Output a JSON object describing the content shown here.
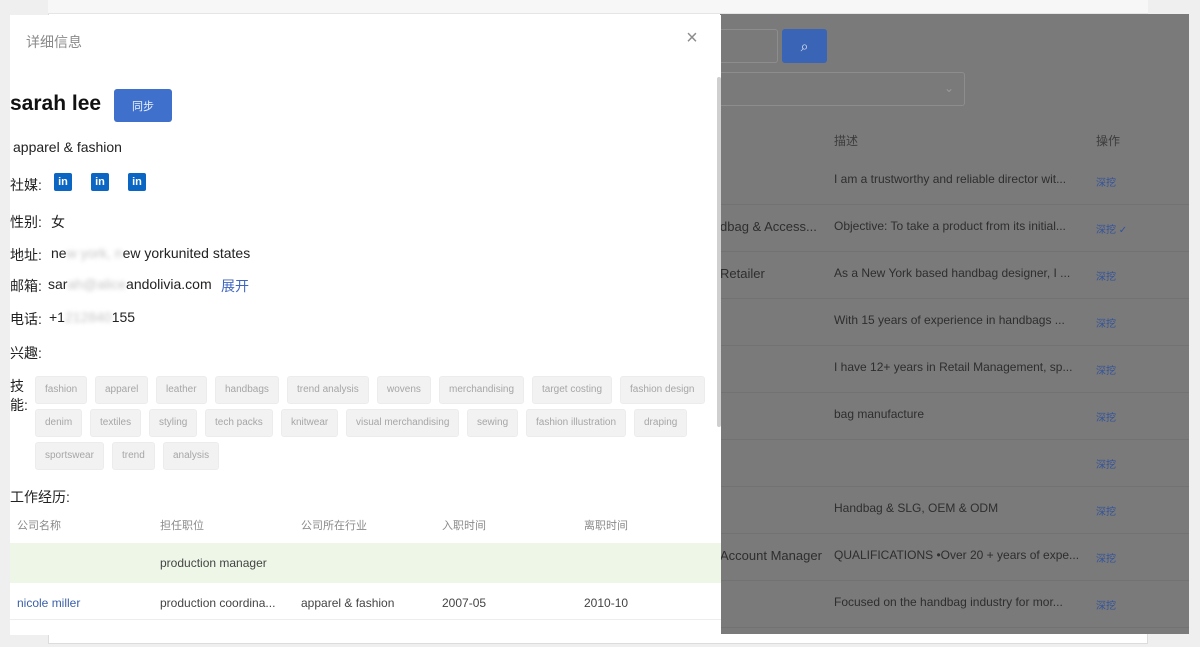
{
  "modal": {
    "title": "详细信息",
    "close": "×",
    "name": "sarah lee",
    "sync_label": "同步",
    "industry": "apparel & fashion",
    "social_label": "社媒:",
    "gender_label": "性别:",
    "gender_value": "女",
    "address_label": "地址:",
    "address_value": {
      "start": "ne",
      "hidden": "w york, n",
      "end": "ew yorkunited states"
    },
    "email_label": "邮箱:",
    "email_value": {
      "start": "sar",
      "hidden": "ah@alice",
      "end": "andolivia.com"
    },
    "expand_label": "展开",
    "phone_label": "电话:",
    "phone_value": {
      "start": "+1",
      "hidden": "212840",
      "end": "155"
    },
    "interests_label": "兴趣:",
    "skills_label_1": "技",
    "skills_label_2": "能:",
    "work_label": "工作经历:",
    "social_icons": [
      "linkedin-icon",
      "linkedin-icon",
      "linkedin-icon"
    ],
    "skill_rows": [
      [
        "fashion",
        "apparel",
        "leather",
        "handbags",
        "trend analysis",
        "wovens",
        "merchandising",
        "target costing",
        "fashion design"
      ],
      [
        "denim",
        "textiles",
        "styling",
        "tech packs",
        "knitwear",
        "visual merchandising",
        "sewing",
        "fashion illustration",
        "draping"
      ],
      [
        "sportswear",
        "trend",
        "analysis"
      ]
    ],
    "work_columns": [
      "公司名称",
      "担任职位",
      "公司所在行业",
      "入职时间",
      "离职时间"
    ],
    "work_rows": [
      [
        "",
        "production manager",
        "",
        "",
        ""
      ],
      [
        "nicole miller",
        "production coordina...",
        "apparel & fashion",
        "2007-05",
        "2010-10"
      ]
    ]
  },
  "background": {
    "search_icon": "search-icon",
    "columns": {
      "desc": "描述",
      "op": "操作"
    },
    "rows": [
      {
        "left": "",
        "desc": "I am a trustworthy and reliable director wit...",
        "op": "深挖"
      },
      {
        "left": "dbag & Access...",
        "desc": "Objective: To take a product from its initial...",
        "op": "深挖 ✓"
      },
      {
        "left": "Retailer",
        "desc": "As a New York based handbag designer, I ...",
        "op": "深挖"
      },
      {
        "left": "",
        "desc": "With 15 years of experience in handbags ...",
        "op": "深挖"
      },
      {
        "left": "",
        "desc": "I have 12+ years in Retail Management, sp...",
        "op": "深挖"
      },
      {
        "left": "",
        "desc": "bag manufacture",
        "op": "深挖"
      },
      {
        "left": "",
        "desc": "",
        "op": "深挖"
      },
      {
        "left": "",
        "desc": "Handbag & SLG, OEM & ODM",
        "op": "深挖"
      },
      {
        "left": "Account Manager",
        "desc": "QUALIFICATIONS •Over 20 + years of expe...",
        "op": "深挖"
      },
      {
        "left": "",
        "desc": "Focused on the handbag industry for mor...",
        "op": "深挖"
      }
    ]
  }
}
